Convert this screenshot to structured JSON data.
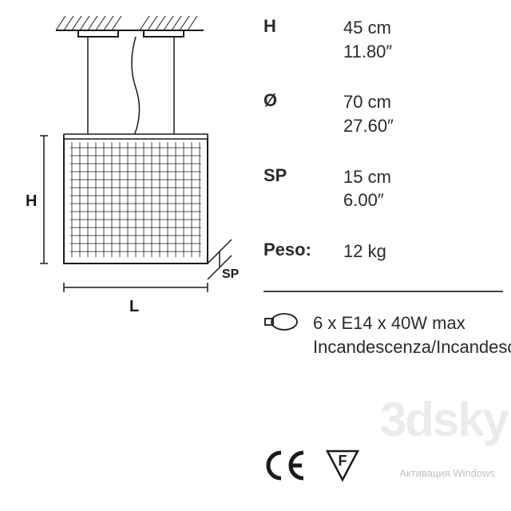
{
  "specs": {
    "H": {
      "label": "H",
      "metric": "45 cm",
      "imperial": "11.80″"
    },
    "D": {
      "label": "Ø",
      "metric": "70 cm",
      "imperial": "27.60″"
    },
    "SP": {
      "label": "SP",
      "metric": "15 cm",
      "imperial": "6.00″"
    },
    "Peso": {
      "label": "Peso:",
      "value": "12 kg"
    }
  },
  "bulb": {
    "line1": "6 x E14 x 40W max",
    "line2": "Incandescenza/Incandescent"
  },
  "diagram": {
    "labels": {
      "H": "H",
      "L": "L",
      "SP": "SP"
    }
  },
  "certifications": {
    "ce": "CE",
    "f_mark": "F"
  },
  "watermark": {
    "brand": "3dsky",
    "os": "Активация Windows"
  }
}
